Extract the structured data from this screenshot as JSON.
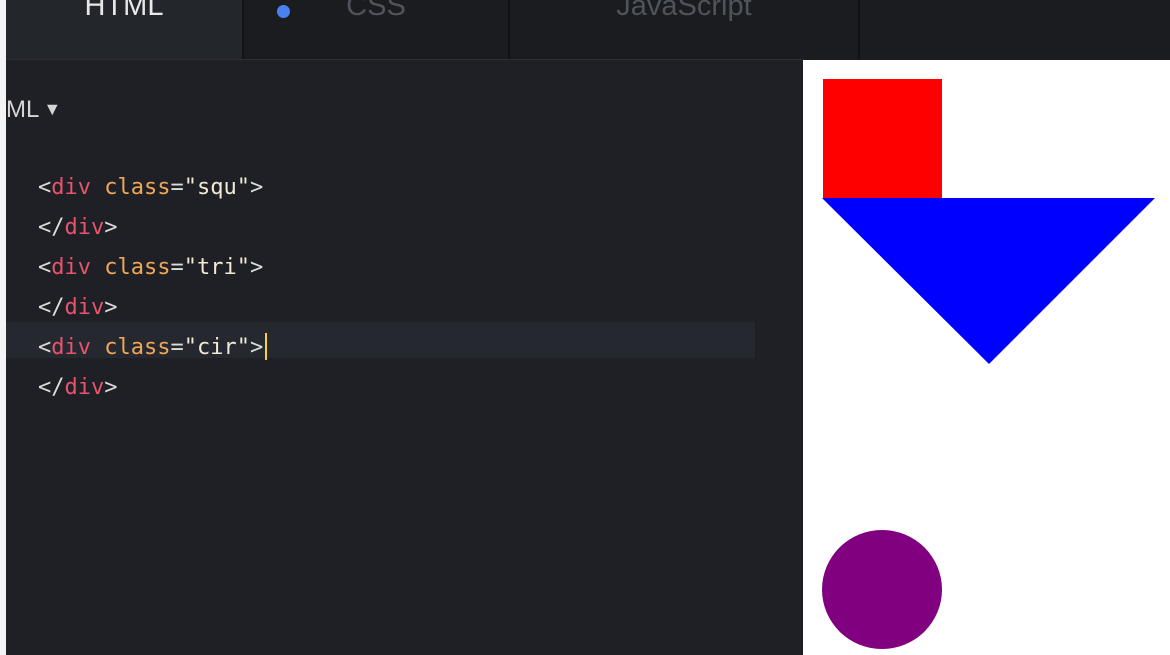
{
  "tabs": [
    {
      "label": "HTML",
      "active": true,
      "modified": false
    },
    {
      "label": "CSS",
      "active": false,
      "modified": true
    },
    {
      "label": "JavaScript",
      "active": false,
      "modified": false
    }
  ],
  "editor": {
    "panel_header": "ML",
    "panel_caret_icon": "caret-down-icon",
    "lines": [
      {
        "open": "<",
        "tag": "div",
        "attr": "class",
        "eq": "=",
        "value": "\"squ\"",
        "close": ">"
      },
      {
        "open": "</",
        "tag": "div",
        "close": ">"
      },
      {
        "open": "<",
        "tag": "div",
        "attr": "class",
        "eq": "=",
        "value": "\"tri\"",
        "close": ">"
      },
      {
        "open": "</",
        "tag": "div",
        "close": ">"
      },
      {
        "open": "<",
        "tag": "div",
        "attr": "class",
        "eq": "=",
        "value": "\"cir\"",
        "close": ">"
      },
      {
        "open": "</",
        "tag": "div",
        "close": ">"
      }
    ],
    "cursor_line": 5
  },
  "colors": {
    "editor_bg": "#1e2025",
    "tab_bar_bg": "#1a1c20",
    "tag": "#e8546c",
    "attribute": "#f2a65a",
    "string": "#f0ead6",
    "cursor": "#f7d13b",
    "modified_dot": "#4a80f0"
  },
  "preview": {
    "shapes": [
      {
        "name": "square",
        "color": "#ff0000"
      },
      {
        "name": "triangle",
        "color": "#0000ff"
      },
      {
        "name": "circle",
        "color": "#800080"
      }
    ]
  }
}
